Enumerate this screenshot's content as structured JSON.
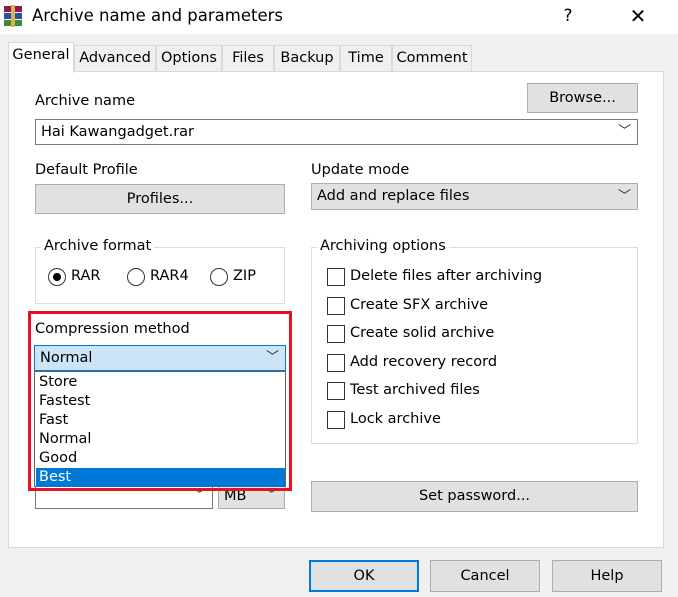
{
  "window": {
    "title": "Archive name and parameters",
    "help_glyph": "?",
    "close_glyph": "✕"
  },
  "tabs": [
    "General",
    "Advanced",
    "Options",
    "Files",
    "Backup",
    "Time",
    "Comment"
  ],
  "archive_name": {
    "label": "Archive name",
    "value": "Hai Kawangadget.rar",
    "browse_label": "Browse..."
  },
  "default_profile": {
    "label": "Default Profile",
    "button_label": "Profiles..."
  },
  "update_mode": {
    "label": "Update mode",
    "value": "Add and replace files"
  },
  "archive_format": {
    "label": "Archive format",
    "options": [
      "RAR",
      "RAR4",
      "ZIP"
    ],
    "selected": "RAR"
  },
  "compression_method": {
    "label": "Compression method",
    "value": "Normal",
    "options": [
      "Store",
      "Fastest",
      "Fast",
      "Normal",
      "Good",
      "Best"
    ],
    "highlighted": "Best"
  },
  "split_volumes": {
    "unit": "MB"
  },
  "archiving_options": {
    "label": "Archiving options",
    "items": [
      "Delete files after archiving",
      "Create SFX archive",
      "Create solid archive",
      "Add recovery record",
      "Test archived files",
      "Lock archive"
    ]
  },
  "set_password_label": "Set password...",
  "footer": {
    "ok": "OK",
    "cancel": "Cancel",
    "help": "Help"
  },
  "colors": {
    "selection": "#0078d7",
    "highlight_box": "#e81123",
    "focus_border": "#0078d7"
  }
}
